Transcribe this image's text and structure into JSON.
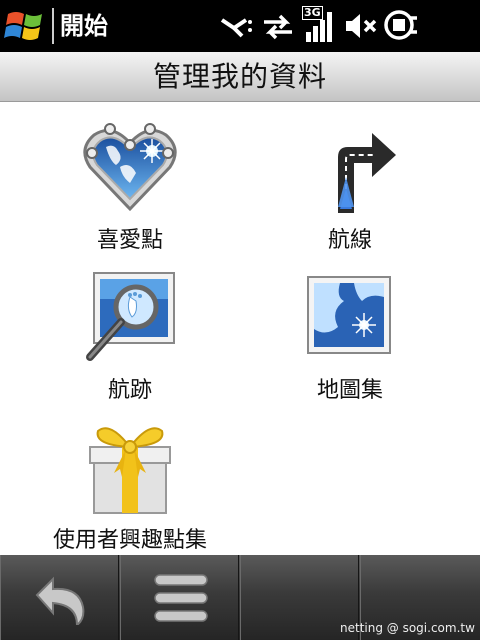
{
  "status_bar": {
    "start_label": "開始",
    "network_badge": "3G"
  },
  "title": "管理我的資料",
  "menu": [
    {
      "label": "喜愛點",
      "icon": "heart-icon"
    },
    {
      "label": "航線",
      "icon": "route-arrow-icon"
    },
    {
      "label": "航跡",
      "icon": "footprint-magnifier-icon"
    },
    {
      "label": "地圖集",
      "icon": "map-icon"
    },
    {
      "label": "使用者興趣點集",
      "icon": "gift-box-icon"
    }
  ],
  "softkeys": [
    {
      "icon": "back-icon"
    },
    {
      "icon": "menu-icon"
    },
    {
      "icon": ""
    },
    {
      "icon": ""
    }
  ],
  "watermark": "netting   @ sogi.com.tw",
  "colors": {
    "status_bar": "#000000",
    "softkey_bar": "#3a3a3a"
  }
}
